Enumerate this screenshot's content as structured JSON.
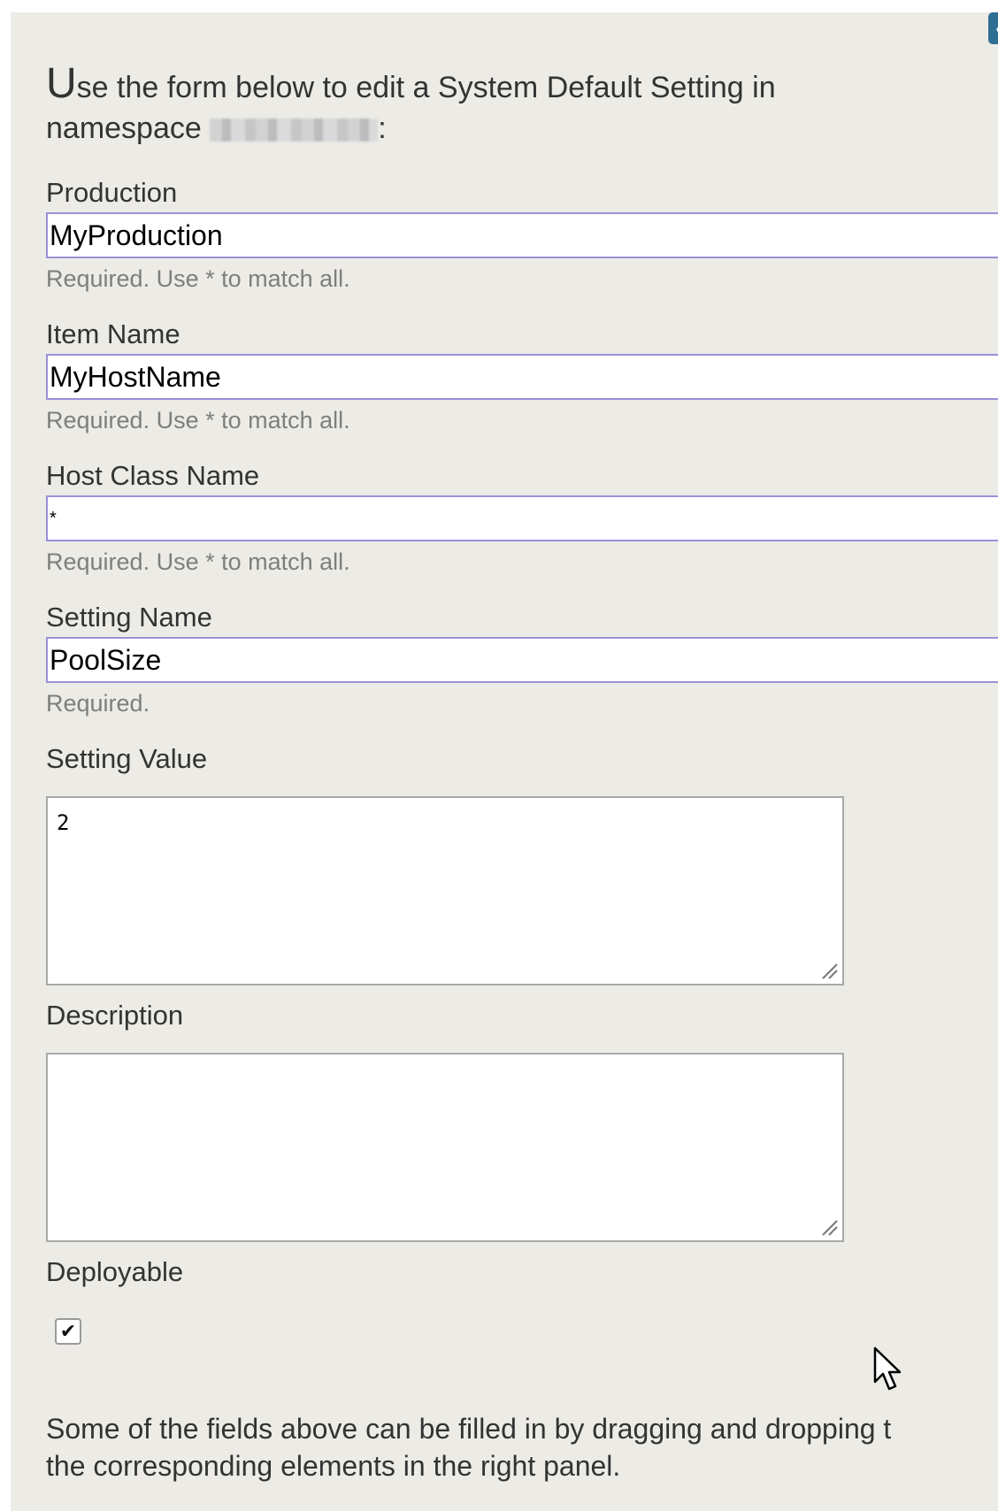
{
  "intro": {
    "first_letter": "U",
    "rest_line1": "se the form below to edit a System Default Setting in",
    "line2_prefix": "namespace ",
    "line2_suffix": ":"
  },
  "form": {
    "production": {
      "label": "Production",
      "value": "MyProduction",
      "hint": "Required. Use * to match all."
    },
    "item_name": {
      "label": "Item Name",
      "value": "MyHostName",
      "hint": "Required. Use * to match all."
    },
    "host_class_name": {
      "label": "Host Class Name",
      "value": "*",
      "hint": "Required. Use * to match all."
    },
    "setting_name": {
      "label": "Setting Name",
      "value": "PoolSize",
      "hint": "Required."
    },
    "setting_value": {
      "label": "Setting Value",
      "value": "2"
    },
    "description": {
      "label": "Description",
      "value": ""
    },
    "deployable": {
      "label": "Deployable",
      "checked": true,
      "check_glyph": "✔"
    }
  },
  "footer": {
    "line1": "Some of the fields above can be filled in by dragging and dropping t",
    "line2": "the corresponding elements in the right panel."
  },
  "icons": {
    "corner_tab": "chevron-left-icon",
    "cursor": "mouse-pointer-icon",
    "checkbox": "checkmark-icon"
  },
  "colors": {
    "panel_background": "#ecebe6",
    "input_border": "#9a90d8",
    "hint_text": "#7e7e7e",
    "corner_tab": "#2f6f93"
  }
}
